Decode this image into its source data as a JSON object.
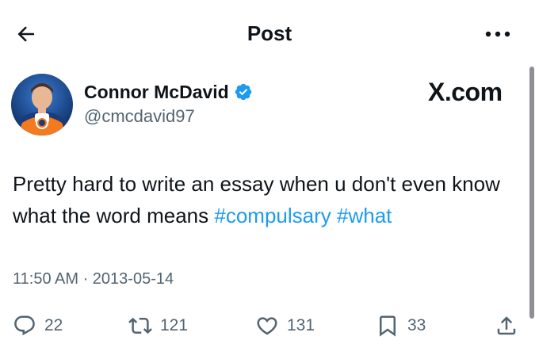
{
  "header": {
    "title": "Post"
  },
  "author": {
    "display_name": "Connor McDavid",
    "handle": "@cmcdavid97",
    "verified": true
  },
  "watermark": "X.com",
  "tweet": {
    "text_plain": "Pretty hard to write an essay when u don't even know what the word means",
    "hashtags": [
      "#compulsary",
      "#what"
    ],
    "timestamp": "11:50 AM · 2013-05-14"
  },
  "actions": {
    "replies": "22",
    "reposts": "121",
    "likes": "131",
    "bookmarks": "33"
  },
  "colors": {
    "accent": "#1d9bf0",
    "secondary_text": "#536471",
    "primary_text": "#0f1419"
  },
  "icons": [
    "back-arrow-icon",
    "more-icon",
    "verified-badge-icon",
    "reply-icon",
    "repost-icon",
    "like-icon",
    "bookmark-icon",
    "share-icon"
  ]
}
